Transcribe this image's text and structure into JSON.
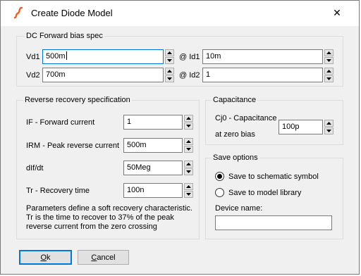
{
  "window": {
    "title": "Create Diode Model",
    "close_glyph": "✕",
    "icon": "spice-model-icon"
  },
  "forward": {
    "label": "DC Forward bias spec",
    "vd1_label": "Vd1",
    "vd1_value": "500m",
    "id1_label": "@ Id1",
    "id1_value": "10m",
    "vd2_label": "Vd2",
    "vd2_value": "700m",
    "id2_label": "@ Id2",
    "id2_value": "1"
  },
  "reverse": {
    "label": "Reverse recovery specification",
    "if_label": "IF - Forward current",
    "if_value": "1",
    "irm_label": "IRM - Peak reverse current",
    "irm_value": "500m",
    "dif_label": "dIf/dt",
    "dif_value": "50Meg",
    "tr_label": "Tr - Recovery time",
    "tr_value": "100n",
    "note": "Parameters define a soft recovery characteristic.\nTr is the time to recover to 37% of the peak\nreverse current from the zero crossing"
  },
  "capacitance": {
    "label": "Capacitance",
    "cj0_label_line1": "Cj0 - Capacitance",
    "cj0_label_line2": "at zero bias",
    "cj0_value": "100p"
  },
  "save": {
    "label": "Save options",
    "option_schematic": "Save to schematic symbol",
    "option_library": "Save to model library",
    "selected": "schematic",
    "device_label": "Device name:",
    "device_value": ""
  },
  "buttons": {
    "ok_mnemonic": "O",
    "ok_rest": "k",
    "cancel_mnemonic": "C",
    "cancel_rest": "ancel"
  }
}
